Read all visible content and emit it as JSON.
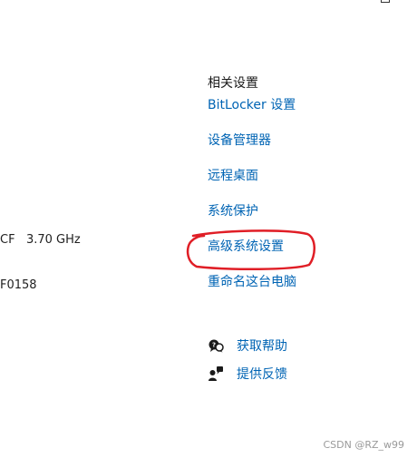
{
  "sysinfo": {
    "cpu_text": "CF   3.70 GHz",
    "id_text": "F0158"
  },
  "related": {
    "title": "相关设置",
    "links": [
      {
        "label": "BitLocker 设置"
      },
      {
        "label": "设备管理器"
      },
      {
        "label": "远程桌面"
      },
      {
        "label": "系统保护"
      },
      {
        "label": "高级系统设置"
      },
      {
        "label": "重命名这台电脑"
      }
    ]
  },
  "help": {
    "items": [
      {
        "label": "获取帮助",
        "icon": "help-chat-icon"
      },
      {
        "label": "提供反馈",
        "icon": "feedback-icon"
      }
    ]
  },
  "annotation": {
    "color": "#e01e26"
  },
  "colors": {
    "link": "#0064b4"
  },
  "watermark": "CSDN @RZ_w99"
}
